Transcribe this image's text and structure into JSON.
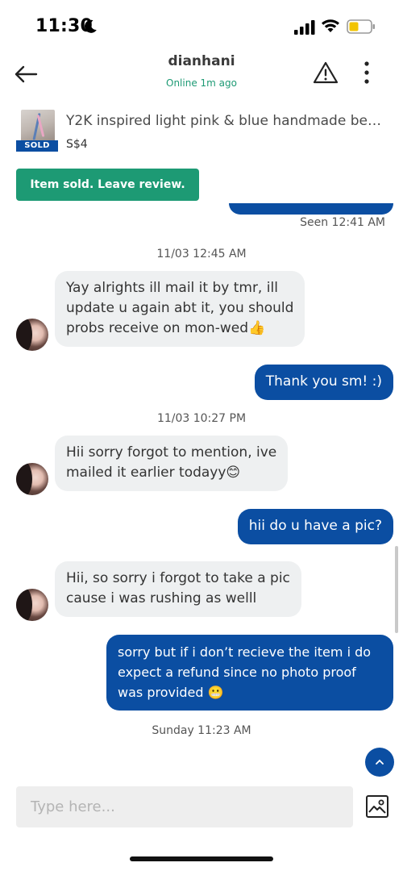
{
  "status_bar": {
    "time": "11:30",
    "icons": [
      "moon-icon",
      "signal-icon",
      "wifi-icon",
      "battery-icon"
    ]
  },
  "header": {
    "username": "dianhani",
    "online_status": "Online 1m ago",
    "icons": [
      "back-arrow-icon",
      "warning-icon",
      "more-vertical-icon"
    ]
  },
  "listing": {
    "title": "Y2K inspired light pink & blue handmade be…",
    "price": "S$4",
    "badge": "SOLD"
  },
  "review_button": {
    "label": "Item sold. Leave review."
  },
  "chat": {
    "seen_label": "Seen 12:41 AM",
    "messages": [
      {
        "type": "timestamp",
        "text": "11/03 12:45 AM"
      },
      {
        "type": "incoming",
        "lines": [
          "Yay alrights ill mail it by tmr, ill",
          "update u again abt it, you should",
          "probs receive on mon-wed👍"
        ]
      },
      {
        "type": "outgoing",
        "lines": [
          "Thank you sm! :)"
        ]
      },
      {
        "type": "timestamp",
        "text": "11/03 10:27 PM"
      },
      {
        "type": "incoming",
        "lines": [
          "Hii sorry forgot to mention, ive",
          "mailed it earlier todayy😊"
        ]
      },
      {
        "type": "outgoing",
        "lines": [
          "hii do u have a pic?"
        ]
      },
      {
        "type": "incoming",
        "lines": [
          "Hii, so sorry i forgot to take a pic",
          "cause i was rushing as welll"
        ]
      },
      {
        "type": "outgoing",
        "lines": [
          "sorry but if i don’t recieve the item i do",
          "expect a refund since no photo proof",
          "was provided 😬"
        ]
      },
      {
        "type": "timestamp",
        "text": "Sunday 11:23 AM"
      }
    ]
  },
  "composer": {
    "placeholder": "Type here...",
    "value": ""
  },
  "colors": {
    "brand_blue": "#0b4ea2",
    "brand_green": "#1d9a74",
    "incoming_bubble": "#eef0f1"
  }
}
